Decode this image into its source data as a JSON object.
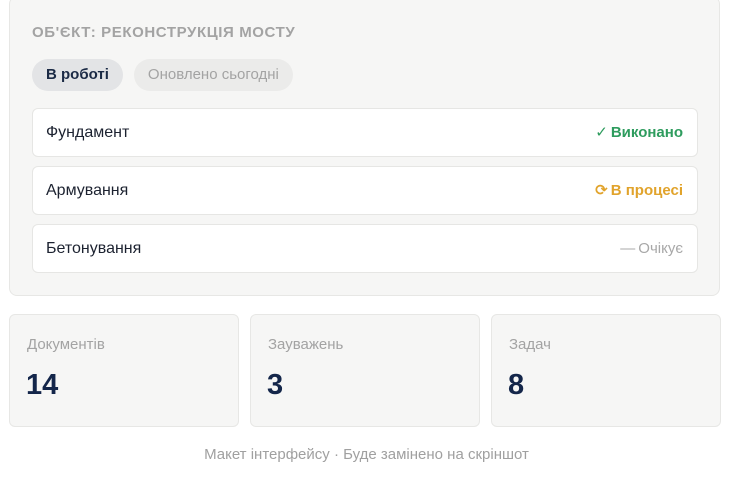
{
  "object": {
    "title": "ОБ'ЄКТ: РЕКОНСТРУКЦІЯ МОСТУ",
    "chips": [
      {
        "label": "В роботі"
      },
      {
        "label": "Оновлено сьогодні"
      }
    ],
    "stages": [
      {
        "name": "Фундамент",
        "status_icon": "✓",
        "status": "Виконано",
        "status_color": "#2e9c5e"
      },
      {
        "name": "Армування",
        "status_icon": "⟳",
        "status": "В процесі",
        "status_color": "#e1a32b"
      },
      {
        "name": "Бетонування",
        "status_icon": "—",
        "status": "Очікує",
        "status_color": "#a8a8a8"
      }
    ]
  },
  "stats": [
    {
      "label": "Документів",
      "value": "14"
    },
    {
      "label": "Зауважень",
      "value": "3"
    },
    {
      "label": "Задач",
      "value": "8"
    }
  ],
  "footer": {
    "note": "Макет інтерфейсу · Буде замінено на скріншот"
  },
  "colors": {
    "accent_navy": "#14264a",
    "done": "#2e9c5e",
    "in_progress": "#e1a32b",
    "pending": "#a8a8a8"
  }
}
